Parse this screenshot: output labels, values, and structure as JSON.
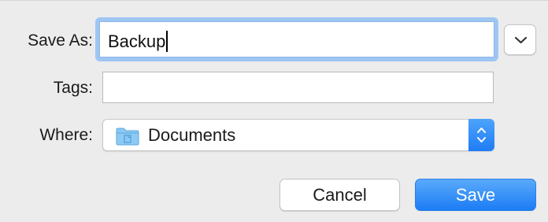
{
  "dialog": {
    "save_as_label": "Save As:",
    "save_as_value": "Backup",
    "tags_label": "Tags:",
    "tags_value": "",
    "where_label": "Where:",
    "where_value": "Documents",
    "where_icon": "folder-icon",
    "expand_icon": "chevron-down-icon",
    "stepper_icon": "up-down-arrows-icon"
  },
  "buttons": {
    "cancel_label": "Cancel",
    "save_label": "Save"
  },
  "colors": {
    "background": "#ececec",
    "accent": "#1f7df5",
    "focus_ring": "#9ec6f3",
    "folder": "#6fb9f0"
  }
}
